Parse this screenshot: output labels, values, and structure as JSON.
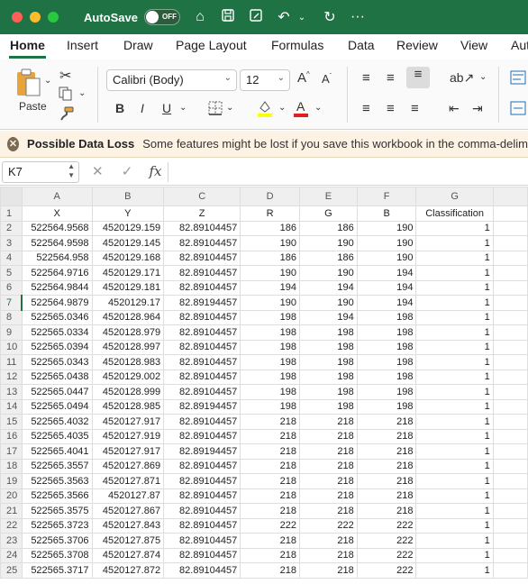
{
  "titlebar": {
    "autosave_label": "AutoSave",
    "autosave_state": "OFF",
    "icons": [
      "home-icon",
      "save-icon",
      "save-as-icon",
      "undo-icon",
      "redo-icon",
      "more-icon"
    ],
    "accent_color": "#1f7244"
  },
  "ribbon_tabs": [
    "Home",
    "Insert",
    "Draw",
    "Page Layout",
    "Formulas",
    "Data",
    "Review",
    "View",
    "Aut"
  ],
  "ribbon": {
    "paste_label": "Paste",
    "font_name": "Calibri (Body)",
    "font_size": "12",
    "bold": "B",
    "italic": "I",
    "underline": "U",
    "highlight_color": "#ffff00",
    "font_color": "#e02020"
  },
  "message_bar": {
    "title": "Possible Data Loss",
    "text": "Some features might be lost if you save this workbook in the comma-delim"
  },
  "formula_bar": {
    "name_box": "K7",
    "fx_label": "fx"
  },
  "sheet": {
    "selected_row": 7,
    "col_letters": [
      "A",
      "B",
      "C",
      "D",
      "E",
      "F",
      "G"
    ],
    "rows": [
      [
        "X",
        "Y",
        "Z",
        "R",
        "G",
        "B",
        "Classification"
      ],
      [
        "522564.9568",
        "4520129.159",
        "82.89104457",
        "186",
        "186",
        "190",
        "1"
      ],
      [
        "522564.9598",
        "4520129.145",
        "82.89104457",
        "190",
        "190",
        "190",
        "1"
      ],
      [
        "522564.958",
        "4520129.168",
        "82.89104457",
        "186",
        "186",
        "190",
        "1"
      ],
      [
        "522564.9716",
        "4520129.171",
        "82.89104457",
        "190",
        "190",
        "194",
        "1"
      ],
      [
        "522564.9844",
        "4520129.181",
        "82.89104457",
        "194",
        "194",
        "194",
        "1"
      ],
      [
        "522564.9879",
        "4520129.17",
        "82.89194457",
        "190",
        "190",
        "194",
        "1"
      ],
      [
        "522565.0346",
        "4520128.964",
        "82.89104457",
        "198",
        "194",
        "198",
        "1"
      ],
      [
        "522565.0334",
        "4520128.979",
        "82.89104457",
        "198",
        "198",
        "198",
        "1"
      ],
      [
        "522565.0394",
        "4520128.997",
        "82.89104457",
        "198",
        "198",
        "198",
        "1"
      ],
      [
        "522565.0343",
        "4520128.983",
        "82.89104457",
        "198",
        "198",
        "198",
        "1"
      ],
      [
        "522565.0438",
        "4520129.002",
        "82.89104457",
        "198",
        "198",
        "198",
        "1"
      ],
      [
        "522565.0447",
        "4520128.999",
        "82.89104457",
        "198",
        "198",
        "198",
        "1"
      ],
      [
        "522565.0494",
        "4520128.985",
        "82.89194457",
        "198",
        "198",
        "198",
        "1"
      ],
      [
        "522565.4032",
        "4520127.917",
        "82.89104457",
        "218",
        "218",
        "218",
        "1"
      ],
      [
        "522565.4035",
        "4520127.919",
        "82.89104457",
        "218",
        "218",
        "218",
        "1"
      ],
      [
        "522565.4041",
        "4520127.917",
        "82.89194457",
        "218",
        "218",
        "218",
        "1"
      ],
      [
        "522565.3557",
        "4520127.869",
        "82.89104457",
        "218",
        "218",
        "218",
        "1"
      ],
      [
        "522565.3563",
        "4520127.871",
        "82.89104457",
        "218",
        "218",
        "218",
        "1"
      ],
      [
        "522565.3566",
        "4520127.87",
        "82.89104457",
        "218",
        "218",
        "218",
        "1"
      ],
      [
        "522565.3575",
        "4520127.867",
        "82.89104457",
        "218",
        "218",
        "218",
        "1"
      ],
      [
        "522565.3723",
        "4520127.843",
        "82.89104457",
        "222",
        "222",
        "222",
        "1"
      ],
      [
        "522565.3706",
        "4520127.875",
        "82.89104457",
        "218",
        "218",
        "222",
        "1"
      ],
      [
        "522565.3708",
        "4520127.874",
        "82.89104457",
        "218",
        "218",
        "222",
        "1"
      ],
      [
        "522565.3717",
        "4520127.872",
        "82.89104457",
        "218",
        "218",
        "222",
        "1"
      ]
    ]
  }
}
